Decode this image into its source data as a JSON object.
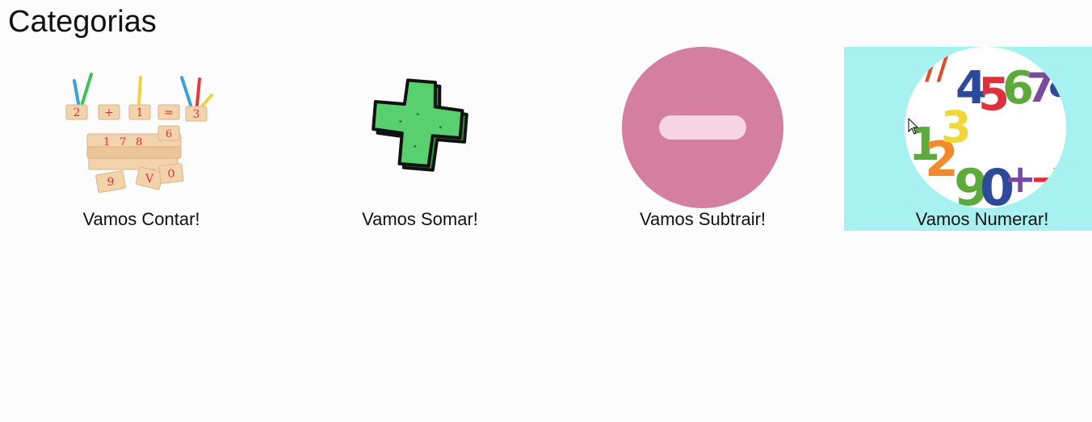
{
  "page": {
    "title": "Categorias"
  },
  "categories": [
    {
      "label": "Vamos Contar!",
      "icon": "counting-blocks-icon"
    },
    {
      "label": "Vamos Somar!",
      "icon": "plus-icon"
    },
    {
      "label": "Vamos Subtrair!",
      "icon": "minus-icon"
    },
    {
      "label": "Vamos Numerar!",
      "icon": "numbers-icon"
    }
  ],
  "colors": {
    "hover_background": "#a8f1f1",
    "minus_circle": "#d47f9f",
    "plus_green": "#4fc96a"
  }
}
